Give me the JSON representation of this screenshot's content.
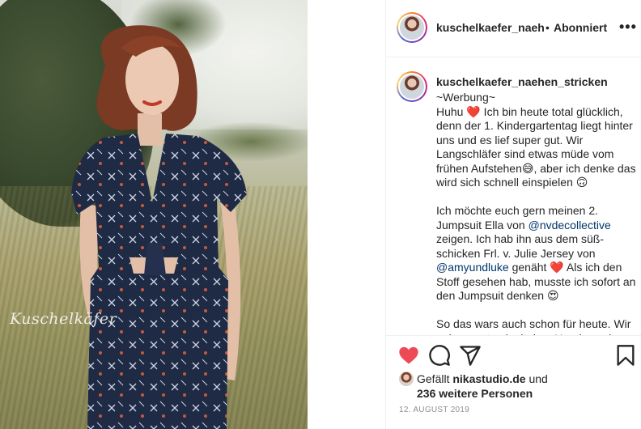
{
  "photo": {
    "watermark": "Kuschelkäfer"
  },
  "header": {
    "username": "kuschelkaefer_naehen_stricken",
    "separator": "•",
    "follow_status": "Abonniert",
    "more_label": "•••"
  },
  "caption": {
    "username": "kuschelkaefer_naehen_stricken",
    "lines": {
      "l1": "~Werbung~",
      "l2a": "Huhu ",
      "l2b": " Ich bin heute total glücklich, denn der 1. Kindergartentag liegt hinter uns und es lief super gut. Wir Langschläfer sind etwas müde vom frühen Aufstehen",
      "l2c": ", aber ich denke das wird sich schnell einspielen ",
      "p2a": "Ich möchte euch gern meinen 2. Jumpsuit Ella von ",
      "mention1": "@nvdecollective",
      "p2b": " zeigen. Ich hab ihn aus dem süß-schicken Frl. v. Julie Jersey von ",
      "mention2": "@amyundluke",
      "p2c": " genäht ",
      "p2d": " Als ich den Stoff gesehen hab, musste ich sofort an den Jumpsuit denken ",
      "p3": "So das wars auch schon für heute. Wir gehen erstmal mit dem Hund spazieren"
    },
    "emoji": {
      "heart": "❤️",
      "grin": "😅",
      "upside": "🙃",
      "hearteyes": "😍"
    }
  },
  "actions": {
    "like_icon": "heart-icon",
    "comment_icon": "comment-icon",
    "share_icon": "share-icon",
    "save_icon": "bookmark-icon"
  },
  "likes": {
    "prefix": "Gefällt ",
    "user": "nikastudio.de",
    "suffix": " und",
    "others": "236 weitere Personen"
  },
  "date": "12. AUGUST 2019",
  "colors": {
    "like_red": "#ed4956",
    "text": "#262626",
    "muted": "#8e8e8e",
    "mention": "#00376b"
  }
}
